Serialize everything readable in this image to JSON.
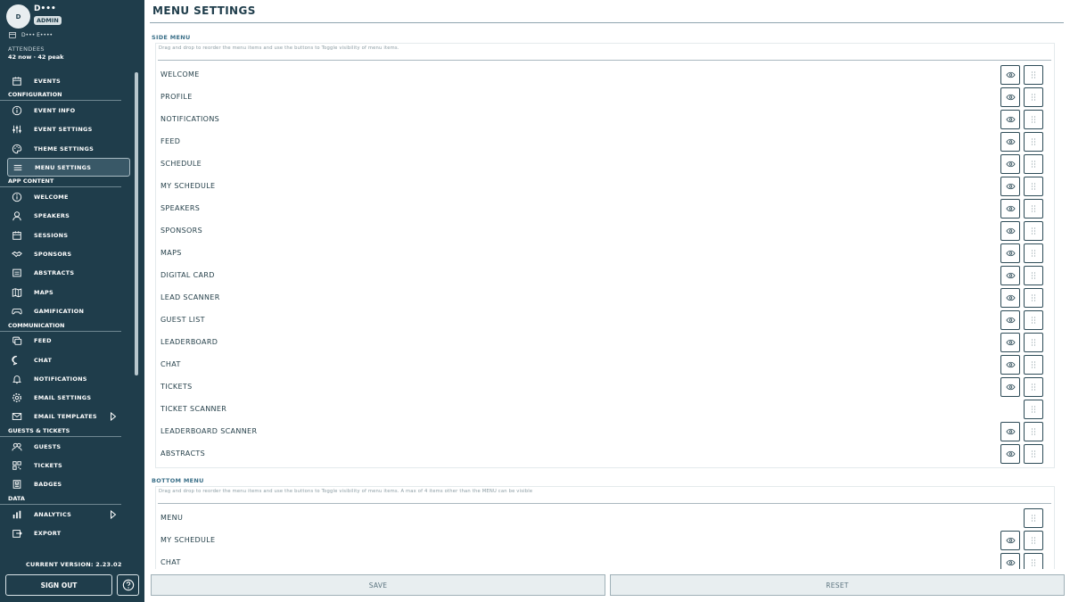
{
  "user": {
    "avatar_initial": "D",
    "name": "D•••",
    "role": "ADMIN"
  },
  "event": {
    "name": "D••• E••••"
  },
  "attendees": {
    "label": "ATTENDEES",
    "value": "42 now · 42 peak"
  },
  "sidebar": {
    "items": [
      {
        "type": "item",
        "label": "EVENTS",
        "icon": "calendar-icon"
      },
      {
        "type": "section",
        "label": "CONFIGURATION"
      },
      {
        "type": "item",
        "label": "EVENT INFO",
        "icon": "info-icon"
      },
      {
        "type": "item",
        "label": "EVENT SETTINGS",
        "icon": "sliders-icon"
      },
      {
        "type": "item",
        "label": "THEME SETTINGS",
        "icon": "palette-icon"
      },
      {
        "type": "item",
        "label": "MENU SETTINGS",
        "icon": "menu-icon",
        "selected": true
      },
      {
        "type": "section",
        "label": "APP CONTENT"
      },
      {
        "type": "item",
        "label": "WELCOME",
        "icon": "info-icon"
      },
      {
        "type": "item",
        "label": "SPEAKERS",
        "icon": "user-icon"
      },
      {
        "type": "item",
        "label": "SESSIONS",
        "icon": "calendar-icon"
      },
      {
        "type": "item",
        "label": "SPONSORS",
        "icon": "handshake-icon"
      },
      {
        "type": "item",
        "label": "ABSTRACTS",
        "icon": "document-icon"
      },
      {
        "type": "item",
        "label": "MAPS",
        "icon": "map-icon"
      },
      {
        "type": "item",
        "label": "GAMIFICATION",
        "icon": "gamepad-icon"
      },
      {
        "type": "section",
        "label": "COMMUNICATION"
      },
      {
        "type": "item",
        "label": "FEED",
        "icon": "feed-icon"
      },
      {
        "type": "item",
        "label": "CHAT",
        "icon": "chat-icon"
      },
      {
        "type": "item",
        "label": "NOTIFICATIONS",
        "icon": "bell-icon"
      },
      {
        "type": "item",
        "label": "EMAIL SETTINGS",
        "icon": "gear-icon"
      },
      {
        "type": "item",
        "label": "EMAIL TEMPLATES",
        "icon": "mail-icon",
        "caret": true
      },
      {
        "type": "section",
        "label": "GUESTS & TICKETS"
      },
      {
        "type": "item",
        "label": "GUESTS",
        "icon": "users-icon"
      },
      {
        "type": "item",
        "label": "TICKETS",
        "icon": "qr-icon"
      },
      {
        "type": "item",
        "label": "BADGES",
        "icon": "badge-icon"
      },
      {
        "type": "section",
        "label": "DATA"
      },
      {
        "type": "item",
        "label": "ANALYTICS",
        "icon": "chart-icon",
        "caret": true
      },
      {
        "type": "item",
        "label": "EXPORT",
        "icon": "export-icon"
      }
    ]
  },
  "version": "CURRENT VERSION: 2.23.02",
  "buttons": {
    "sign_out": "SIGN OUT",
    "save": "SAVE",
    "reset": "RESET"
  },
  "page": {
    "title": "MENU SETTINGS"
  },
  "side_menu": {
    "title": "SIDE MENU",
    "description": "Drag and drop to reorder the menu items and use the buttons to Toggle visibility of menu items.",
    "items": [
      {
        "label": "WELCOME",
        "visible_toggle": true
      },
      {
        "label": "PROFILE",
        "visible_toggle": true
      },
      {
        "label": "NOTIFICATIONS",
        "visible_toggle": true
      },
      {
        "label": "FEED",
        "visible_toggle": true
      },
      {
        "label": "SCHEDULE",
        "visible_toggle": true
      },
      {
        "label": "MY SCHEDULE",
        "visible_toggle": true
      },
      {
        "label": "SPEAKERS",
        "visible_toggle": true
      },
      {
        "label": "SPONSORS",
        "visible_toggle": true
      },
      {
        "label": "MAPS",
        "visible_toggle": true
      },
      {
        "label": "DIGITAL CARD",
        "visible_toggle": true
      },
      {
        "label": "LEAD SCANNER",
        "visible_toggle": true
      },
      {
        "label": "GUEST LIST",
        "visible_toggle": true
      },
      {
        "label": "LEADERBOARD",
        "visible_toggle": true
      },
      {
        "label": "CHAT",
        "visible_toggle": true
      },
      {
        "label": "TICKETS",
        "visible_toggle": true
      },
      {
        "label": "TICKET SCANNER",
        "visible_toggle": false
      },
      {
        "label": "LEADERBOARD SCANNER",
        "visible_toggle": true
      },
      {
        "label": "ABSTRACTS",
        "visible_toggle": true
      }
    ]
  },
  "bottom_menu": {
    "title": "BOTTOM MENU",
    "description": "Drag and drop to reorder the menu items and use the buttons to Toggle visibility of menu items. A max of 4 items other than the MENU can be visible",
    "items": [
      {
        "label": "MENU",
        "visible_toggle": false
      },
      {
        "label": "MY SCHEDULE",
        "visible_toggle": true
      },
      {
        "label": "CHAT",
        "visible_toggle": true
      }
    ]
  }
}
